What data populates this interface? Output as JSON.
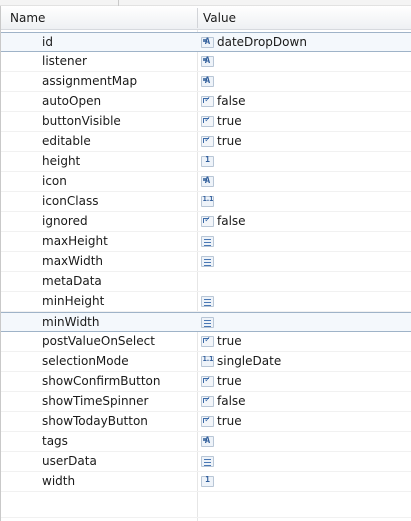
{
  "table": {
    "columns": {
      "name": "Name",
      "value": "Value"
    },
    "rows": [
      {
        "name": "id",
        "icon": "text-property-icon",
        "value": "dateDropDown"
      },
      {
        "name": "listener",
        "icon": "text-property-icon",
        "value": ""
      },
      {
        "name": "assignmentMap",
        "icon": "text-property-icon",
        "value": ""
      },
      {
        "name": "autoOpen",
        "icon": "boolean-property-icon",
        "value": "false"
      },
      {
        "name": "buttonVisible",
        "icon": "boolean-property-icon",
        "value": "true"
      },
      {
        "name": "editable",
        "icon": "boolean-property-icon",
        "value": "true"
      },
      {
        "name": "height",
        "icon": "number-property-icon",
        "value": ""
      },
      {
        "name": "icon",
        "icon": "text-property-icon",
        "value": ""
      },
      {
        "name": "iconClass",
        "icon": "enum-property-icon",
        "value": ""
      },
      {
        "name": "ignored",
        "icon": "boolean-property-icon",
        "value": "false"
      },
      {
        "name": "maxHeight",
        "icon": "list-property-icon",
        "value": ""
      },
      {
        "name": "maxWidth",
        "icon": "list-property-icon",
        "value": ""
      },
      {
        "name": "metaData",
        "icon": "",
        "value": ""
      },
      {
        "name": "minHeight",
        "icon": "list-property-icon",
        "value": ""
      },
      {
        "name": "minWidth",
        "icon": "list-property-icon",
        "value": ""
      },
      {
        "name": "postValueOnSelect",
        "icon": "boolean-property-icon",
        "value": "true"
      },
      {
        "name": "selectionMode",
        "icon": "enum-property-icon",
        "value": "singleDate"
      },
      {
        "name": "showConfirmButton",
        "icon": "boolean-property-icon",
        "value": "true"
      },
      {
        "name": "showTimeSpinner",
        "icon": "boolean-property-icon",
        "value": "false"
      },
      {
        "name": "showTodayButton",
        "icon": "boolean-property-icon",
        "value": "true"
      },
      {
        "name": "tags",
        "icon": "text-property-icon",
        "value": ""
      },
      {
        "name": "userData",
        "icon": "list-property-icon",
        "value": ""
      },
      {
        "name": "width",
        "icon": "number-property-icon",
        "value": ""
      }
    ]
  },
  "colors": {
    "selection_border": "#9fb3c8",
    "icon_blue": "#2e5c9a"
  }
}
